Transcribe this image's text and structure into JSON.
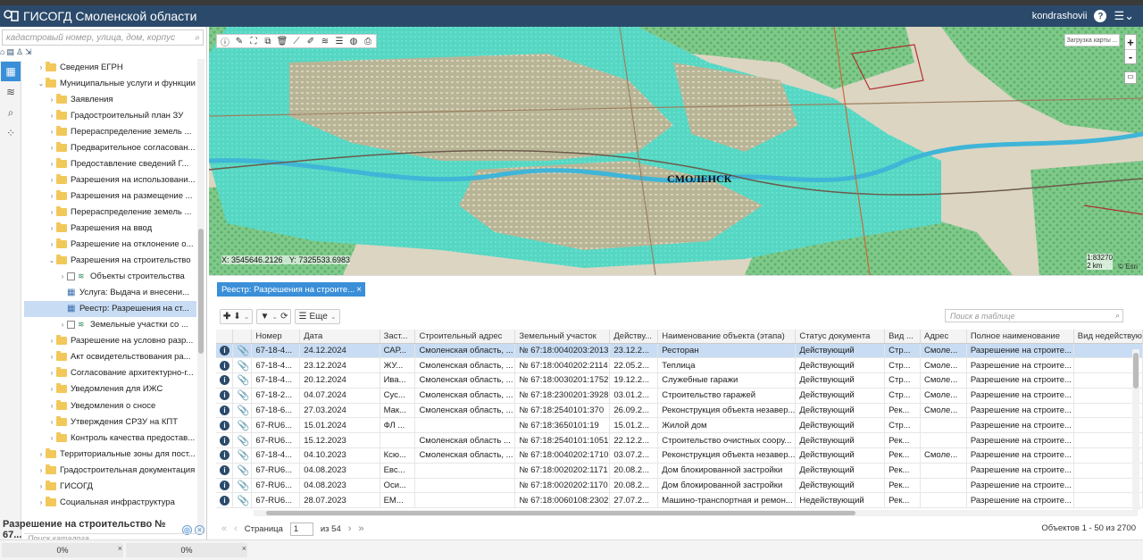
{
  "app": {
    "title": "ГИСОГД Смоленской области",
    "user": "kondrashovii"
  },
  "left": {
    "search_placeholder": "кадастровый номер, улица, дом, корпус",
    "tree": [
      {
        "label": "Сведения ЕГРН",
        "level": 1,
        "type": "folder",
        "arrow": "›"
      },
      {
        "label": "Муниципальные услуги и функции",
        "level": 1,
        "type": "folder",
        "arrow": "⌄"
      },
      {
        "label": "Заявления",
        "level": 2,
        "type": "folder",
        "arrow": "›"
      },
      {
        "label": "Градостроительный план ЗУ",
        "level": 2,
        "type": "folder",
        "arrow": "›"
      },
      {
        "label": "Перераспределение земель ...",
        "level": 2,
        "type": "folder",
        "arrow": "›"
      },
      {
        "label": "Предварительное согласован...",
        "level": 2,
        "type": "folder",
        "arrow": "›"
      },
      {
        "label": "Предоставление сведений Г...",
        "level": 2,
        "type": "folder",
        "arrow": "›"
      },
      {
        "label": "Разрешения на использовани...",
        "level": 2,
        "type": "folder",
        "arrow": "›"
      },
      {
        "label": "Разрешения на размещение ...",
        "level": 2,
        "type": "folder",
        "arrow": "›"
      },
      {
        "label": "Перераспределение земель ...",
        "level": 2,
        "type": "folder",
        "arrow": "›"
      },
      {
        "label": "Разрешения на ввод",
        "level": 2,
        "type": "folder",
        "arrow": "›"
      },
      {
        "label": "Разрешение на отклонение о...",
        "level": 2,
        "type": "folder",
        "arrow": "›"
      },
      {
        "label": "Разрешения на строительство",
        "level": 2,
        "type": "folder",
        "arrow": "⌄"
      },
      {
        "label": "Объекты строительства",
        "level": 3,
        "type": "layer",
        "arrow": "›"
      },
      {
        "label": "Услуга: Выдача и внесени...",
        "level": 3,
        "type": "table",
        "arrow": ""
      },
      {
        "label": "Реестр: Разрешения на ст...",
        "level": 3,
        "type": "table",
        "arrow": "",
        "selected": true
      },
      {
        "label": "Земельные участки со ...",
        "level": 3,
        "type": "layer",
        "arrow": "›"
      },
      {
        "label": "Разрешение на условно разр...",
        "level": 2,
        "type": "folder",
        "arrow": "›"
      },
      {
        "label": "Акт освидетельствования ра...",
        "level": 2,
        "type": "folder",
        "arrow": "›"
      },
      {
        "label": "Согласование архитектурно-г...",
        "level": 2,
        "type": "folder",
        "arrow": "›"
      },
      {
        "label": "Уведомления для ИЖС",
        "level": 2,
        "type": "folder",
        "arrow": "›"
      },
      {
        "label": "Уведомления о сносе",
        "level": 2,
        "type": "folder",
        "arrow": "›"
      },
      {
        "label": "Утверждения СРЗУ на КПТ",
        "level": 2,
        "type": "folder",
        "arrow": "›"
      },
      {
        "label": "Контроль качества предостав...",
        "level": 2,
        "type": "folder",
        "arrow": "›"
      },
      {
        "label": "Территориальные зоны для пост...",
        "level": 1,
        "type": "folder",
        "arrow": "›"
      },
      {
        "label": "Градостроительная документация",
        "level": 1,
        "type": "folder",
        "arrow": "›"
      },
      {
        "label": "ГИСОГД",
        "level": 1,
        "type": "folder",
        "arrow": "›"
      },
      {
        "label": "Социальная инфраструктура",
        "level": 1,
        "type": "folder",
        "arrow": "›"
      }
    ],
    "catalog_search_placeholder": "Поиск каталога",
    "object_title": "Разрешение на строительство № 67..."
  },
  "map": {
    "coord_x": "X: 3545646.2126",
    "coord_y": "Y: 7325533.6983",
    "city_label": "СМОЛЕНСК",
    "scale_text": "1:83270",
    "scale_bar": "2 km",
    "attribution": "© Esri",
    "load_map": "Загрузка карты ...",
    "zoom_in": "+",
    "zoom_out": "-",
    "toolbar_icons": [
      "info-icon",
      "edit-icon",
      "select-icon",
      "copy-icon",
      "delete-icon",
      "measure-icon",
      "draw-icon",
      "layers-icon",
      "list-icon",
      "globe-icon",
      "print-icon"
    ]
  },
  "registry": {
    "tab_label": "Реестр: Разрешения на строите...",
    "more_label": "Еще",
    "search_placeholder": "Поиск в таблице",
    "columns": [
      "",
      "",
      "Номер",
      "Дата",
      "Заст...",
      "Строительный адрес",
      "Земельный участок",
      "Действу...",
      "Наименование объекта (этапа)",
      "Статус документа",
      "Вид ...",
      "Адрес",
      "Полное наименование",
      "Вид недействую"
    ],
    "rows": [
      {
        "num": "67-18-4...",
        "date": "24.12.2024",
        "dev": "САР...",
        "addr": "Смоленская область, ...",
        "land": "№ 67:18:0040203:2013",
        "valid": "23.12.2...",
        "name": "Ресторан",
        "status": "Действующий",
        "kind": "Стр...",
        "address": "Смоле...",
        "full": "Разрешение на строите...",
        "inv": "",
        "clip": true,
        "selected": true
      },
      {
        "num": "67-18-4...",
        "date": "23.12.2024",
        "dev": "ЖУ...",
        "addr": "Смоленская область, ...",
        "land": "№ 67:18:0040202:2114",
        "valid": "22.05.2...",
        "name": "Теплица",
        "status": "Действующий",
        "kind": "Стр...",
        "address": "Смоле...",
        "full": "Разрешение на строите...",
        "inv": "",
        "clip": true
      },
      {
        "num": "67-18-4...",
        "date": "20.12.2024",
        "dev": "Ива...",
        "addr": "Смоленская область, ...",
        "land": "№ 67:18:0030201:1752",
        "valid": "19.12.2...",
        "name": "Служебные гаражи",
        "status": "Действующий",
        "kind": "Стр...",
        "address": "Смоле...",
        "full": "Разрешение на строите...",
        "inv": "",
        "clip": true
      },
      {
        "num": "67-18-2...",
        "date": "04.07.2024",
        "dev": "Сус...",
        "addr": "Смоленская область, ...",
        "land": "№ 67:18:2300201:3928",
        "valid": "03.01.2...",
        "name": "Строительство гаражей",
        "status": "Действующий",
        "kind": "Стр...",
        "address": "Смоле...",
        "full": "Разрешение на строите...",
        "inv": "",
        "clip": false
      },
      {
        "num": "67-18-6...",
        "date": "27.03.2024",
        "dev": "Мак...",
        "addr": "Смоленская область, ...",
        "land": "№ 67:18:2540101:370",
        "valid": "26.09.2...",
        "name": "Реконструкция объекта незавер...",
        "status": "Действующий",
        "kind": "Рек...",
        "address": "Смоле...",
        "full": "Разрешение на строите...",
        "inv": "",
        "clip": true
      },
      {
        "num": "67-RU6...",
        "date": "15.01.2024",
        "dev": "ФЛ ...",
        "addr": "",
        "land": "№ 67:18:3650101:19",
        "valid": "15.01.2...",
        "name": "Жилой дом",
        "status": "Действующий",
        "kind": "Стр...",
        "address": "",
        "full": "Разрешение на строите...",
        "inv": "",
        "clip": true
      },
      {
        "num": "67-RU6...",
        "date": "15.12.2023",
        "dev": "",
        "addr": "Смоленская область ...",
        "land": "№ 67:18:2540101:1051",
        "valid": "22.12.2...",
        "name": "Строительство очистных соору...",
        "status": "Действующий",
        "kind": "Рек...",
        "address": "",
        "full": "Разрешение на строите...",
        "inv": "",
        "clip": true
      },
      {
        "num": "67-18-4...",
        "date": "04.10.2023",
        "dev": "Ксю...",
        "addr": "Смоленская область, ...",
        "land": "№ 67:18:0040202:1710",
        "valid": "03.07.2...",
        "name": "Реконструкция объекта незавер...",
        "status": "Действующий",
        "kind": "Рек...",
        "address": "Смоле...",
        "full": "Разрешение на строите...",
        "inv": "",
        "clip": false
      },
      {
        "num": "67-RU6...",
        "date": "04.08.2023",
        "dev": "Евс...",
        "addr": "",
        "land": "№ 67:18:0020202:1171",
        "valid": "20.08.2...",
        "name": "Дом блокированной застройки",
        "status": "Действующий",
        "kind": "Рек...",
        "address": "",
        "full": "Разрешение на строите...",
        "inv": "",
        "clip": true
      },
      {
        "num": "67-RU6...",
        "date": "04.08.2023",
        "dev": "Оси...",
        "addr": "",
        "land": "№ 67:18:0020202:1170",
        "valid": "20.08.2...",
        "name": "Дом блокированной застройки",
        "status": "Действующий",
        "kind": "Рек...",
        "address": "",
        "full": "Разрешение на строите...",
        "inv": "",
        "clip": true
      },
      {
        "num": "67-RU6...",
        "date": "28.07.2023",
        "dev": "ЕМ...",
        "addr": "",
        "land": "№ 67:18:0060108:2302",
        "valid": "27.07.2...",
        "name": "Машино-транспортная и ремон...",
        "status": "Недействующий",
        "kind": "Рек...",
        "address": "",
        "full": "Разрешение на строите...",
        "inv": "",
        "clip": true
      }
    ],
    "pager": {
      "page_label": "Страница",
      "page": "1",
      "of": "из 54"
    },
    "count": "Объектов 1 - 50 из 2700"
  },
  "status": {
    "progress1": "0%",
    "progress2": "0%"
  }
}
